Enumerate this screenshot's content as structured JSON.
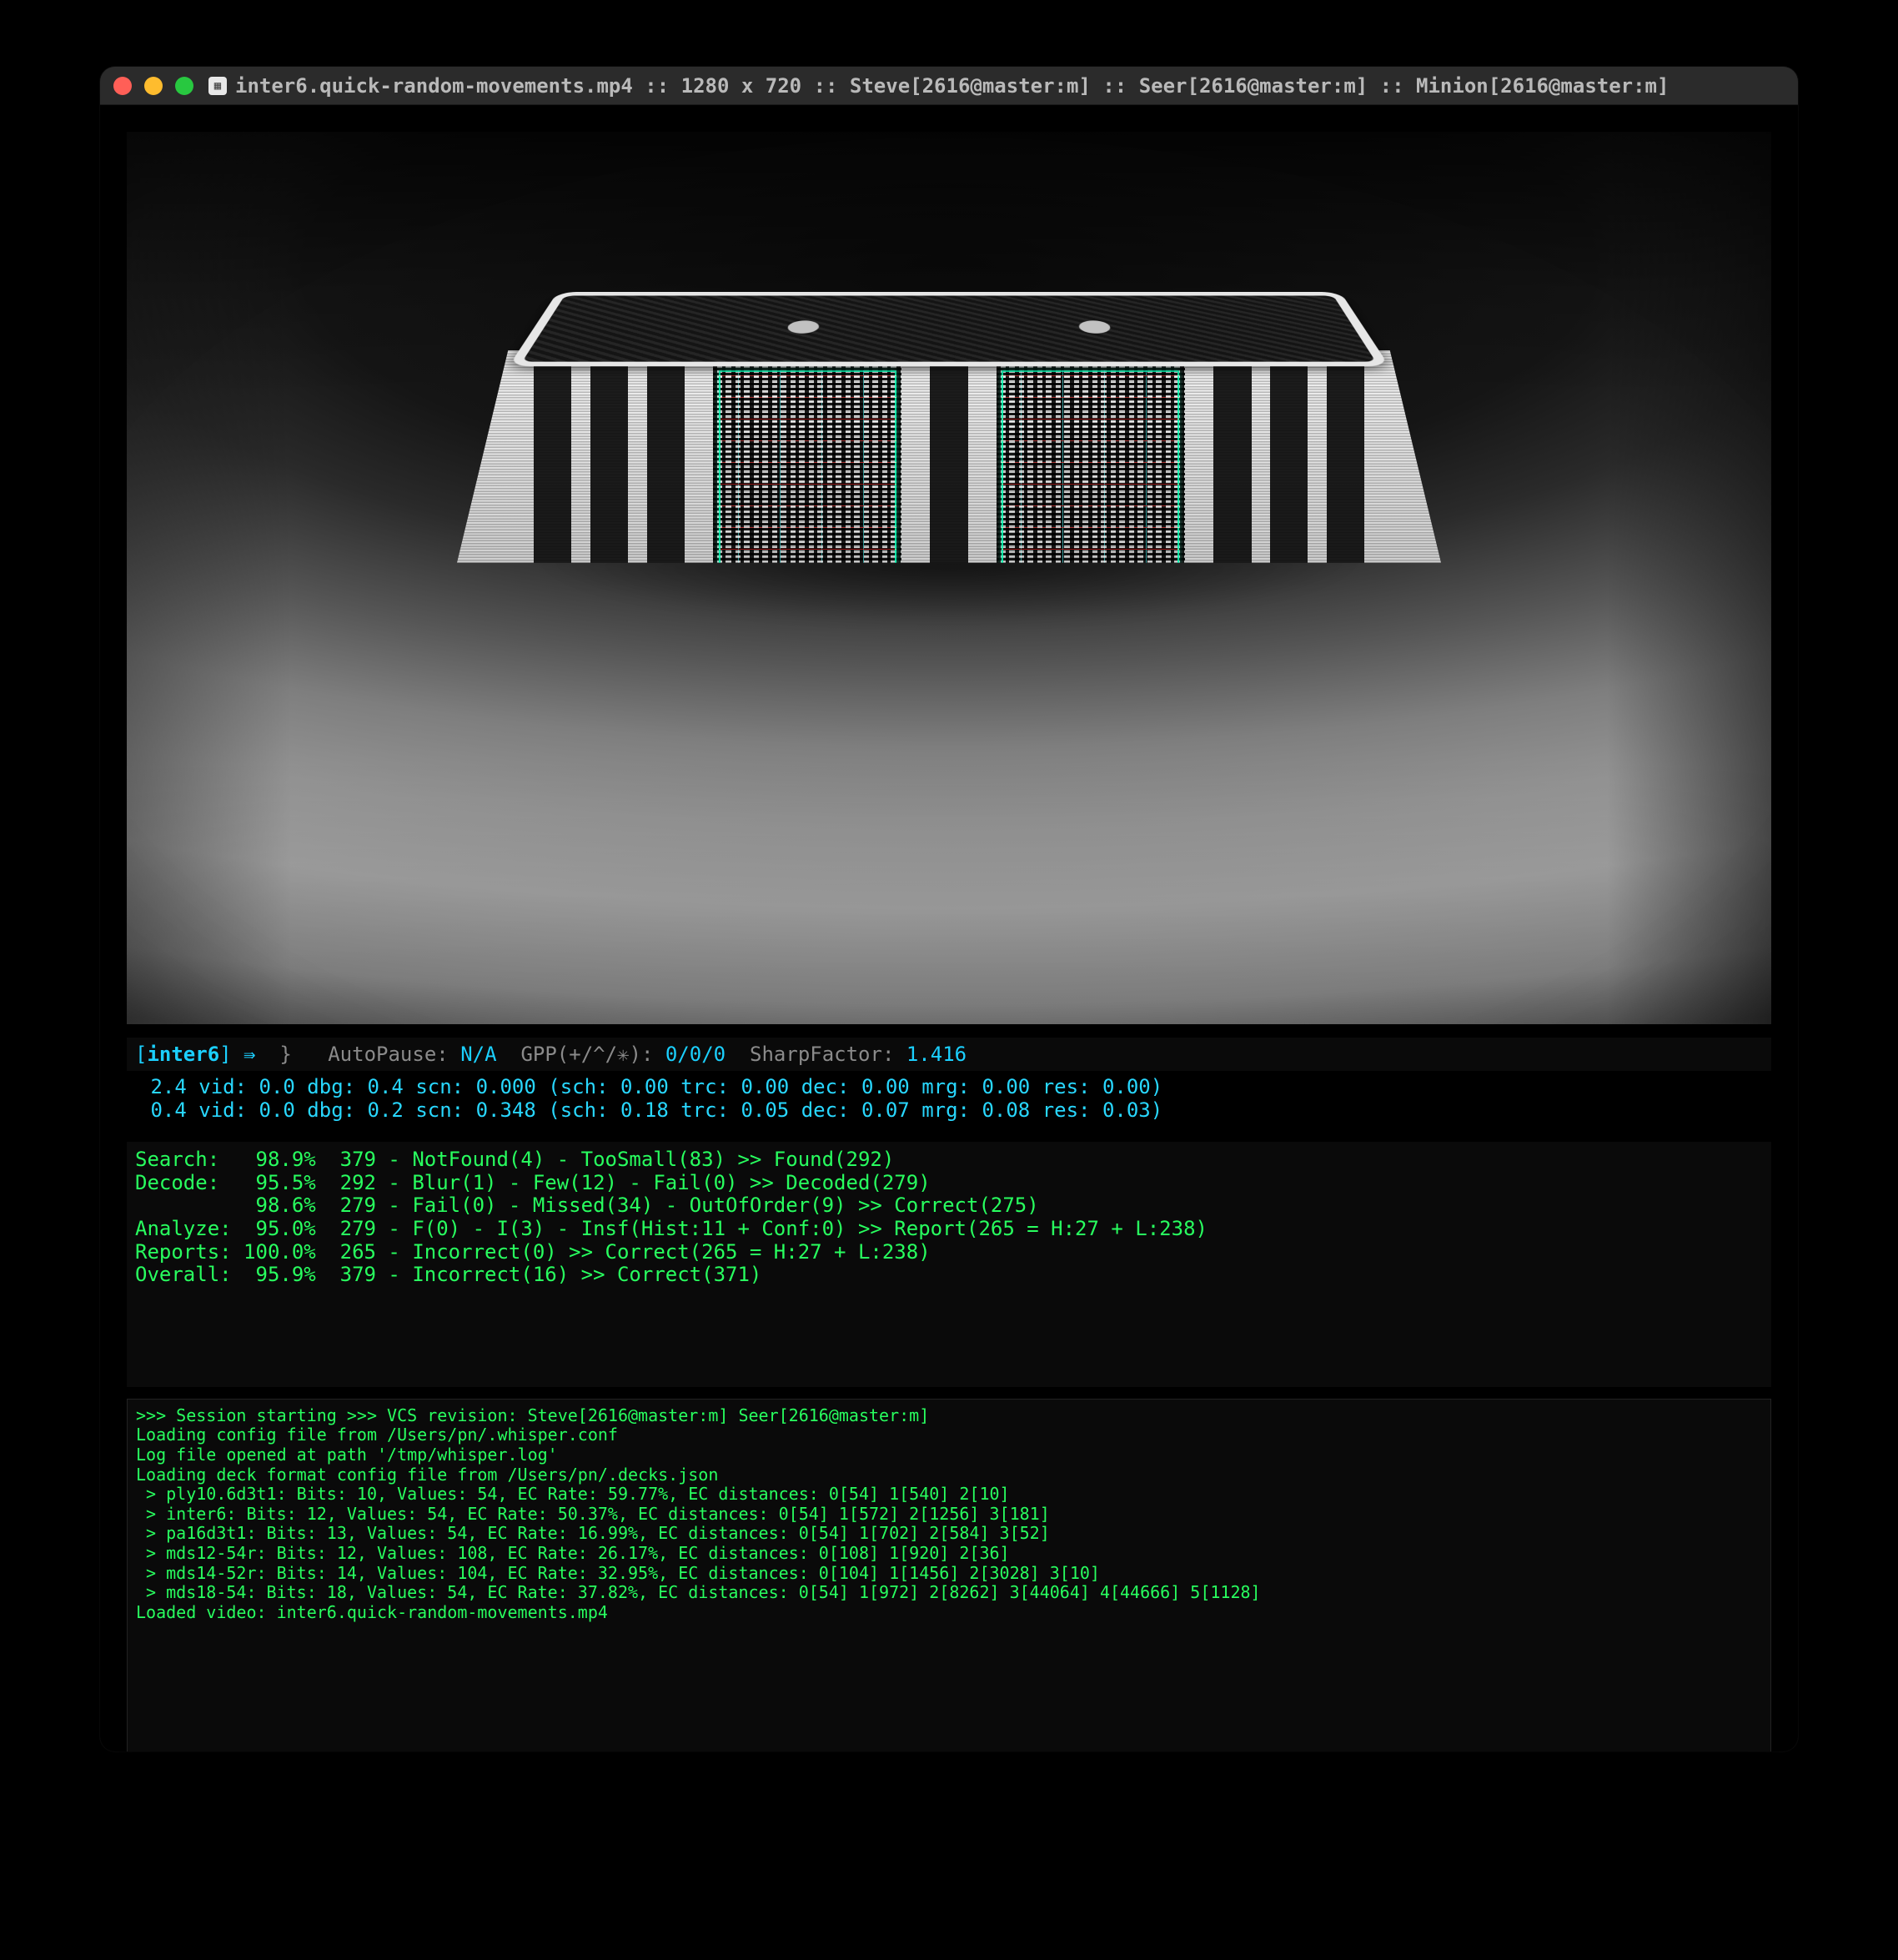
{
  "title": "inter6.quick-random-movements.mp4   ::   1280 x 720   ::   Steve[2616@master:m]   ::   Seer[2616@master:m]   ::   Minion[2616@master:m]",
  "status": {
    "session_label": "inter6",
    "arrow": "⇛",
    "brace": "}",
    "autopause_label": "AutoPause:",
    "autopause_value": "N/A",
    "gpp_label": "GPP(+/^/✳):",
    "gpp_value": "0/0/0",
    "sharp_label": "SharpFactor:",
    "sharp_value": "1.416"
  },
  "timing": {
    "line1": " 2.4 vid: 0.0 dbg: 0.4 scn: 0.000 (sch: 0.00 trc: 0.00 dec: 0.00 mrg: 0.00 res: 0.00)",
    "line2": " 0.4 vid: 0.0 dbg: 0.2 scn: 0.348 (sch: 0.18 trc: 0.05 dec: 0.07 mrg: 0.08 res: 0.03)"
  },
  "stats": {
    "search": "Search:   98.9%  379 - NotFound(4) - TooSmall(83) >> Found(292)",
    "decode": "Decode:   95.5%  292 - Blur(1) - Few(12) - Fail(0) >> Decoded(279)",
    "decode2": "          98.6%  279 - Fail(0) - Missed(34) - OutOfOrder(9) >> Correct(275)",
    "analyze": "Analyze:  95.0%  279 - F(0) - I(3) - Insf(Hist:11 + Conf:0) >> Report(265 = H:27 + L:238)",
    "reports": "Reports: 100.0%  265 - Incorrect(0) >> Correct(265 = H:27 + L:238)",
    "overall": "Overall:  95.9%  379 - Incorrect(16) >> Correct(371)"
  },
  "log": {
    "l1": ">>> Session starting >>> VCS revision: Steve[2616@master:m] Seer[2616@master:m]",
    "l2": "Loading config file from /Users/pn/.whisper.conf",
    "l3": "Log file opened at path '/tmp/whisper.log'",
    "l4": "Loading deck format config file from /Users/pn/.decks.json",
    "l5": " > ply10.6d3t1: Bits: 10, Values: 54, EC Rate: 59.77%, EC distances: 0[54] 1[540] 2[10]",
    "l6": " > inter6: Bits: 12, Values: 54, EC Rate: 50.37%, EC distances: 0[54] 1[572] 2[1256] 3[181]",
    "l7": " > pa16d3t1: Bits: 13, Values: 54, EC Rate: 16.99%, EC distances: 0[54] 1[702] 2[584] 3[52]",
    "l8": " > mds12-54r: Bits: 12, Values: 108, EC Rate: 26.17%, EC distances: 0[108] 1[920] 2[36]",
    "l9": " > mds14-52r: Bits: 14, Values: 104, EC Rate: 32.95%, EC distances: 0[104] 1[1456] 2[3028] 3[10]",
    "l10": " > mds18-54: Bits: 18, Values: 54, EC Rate: 37.82%, EC distances: 0[54] 1[972] 2[8262] 3[44064] 4[44666] 5[1128]",
    "l11": "Loaded video: inter6.quick-random-movements.mp4"
  }
}
